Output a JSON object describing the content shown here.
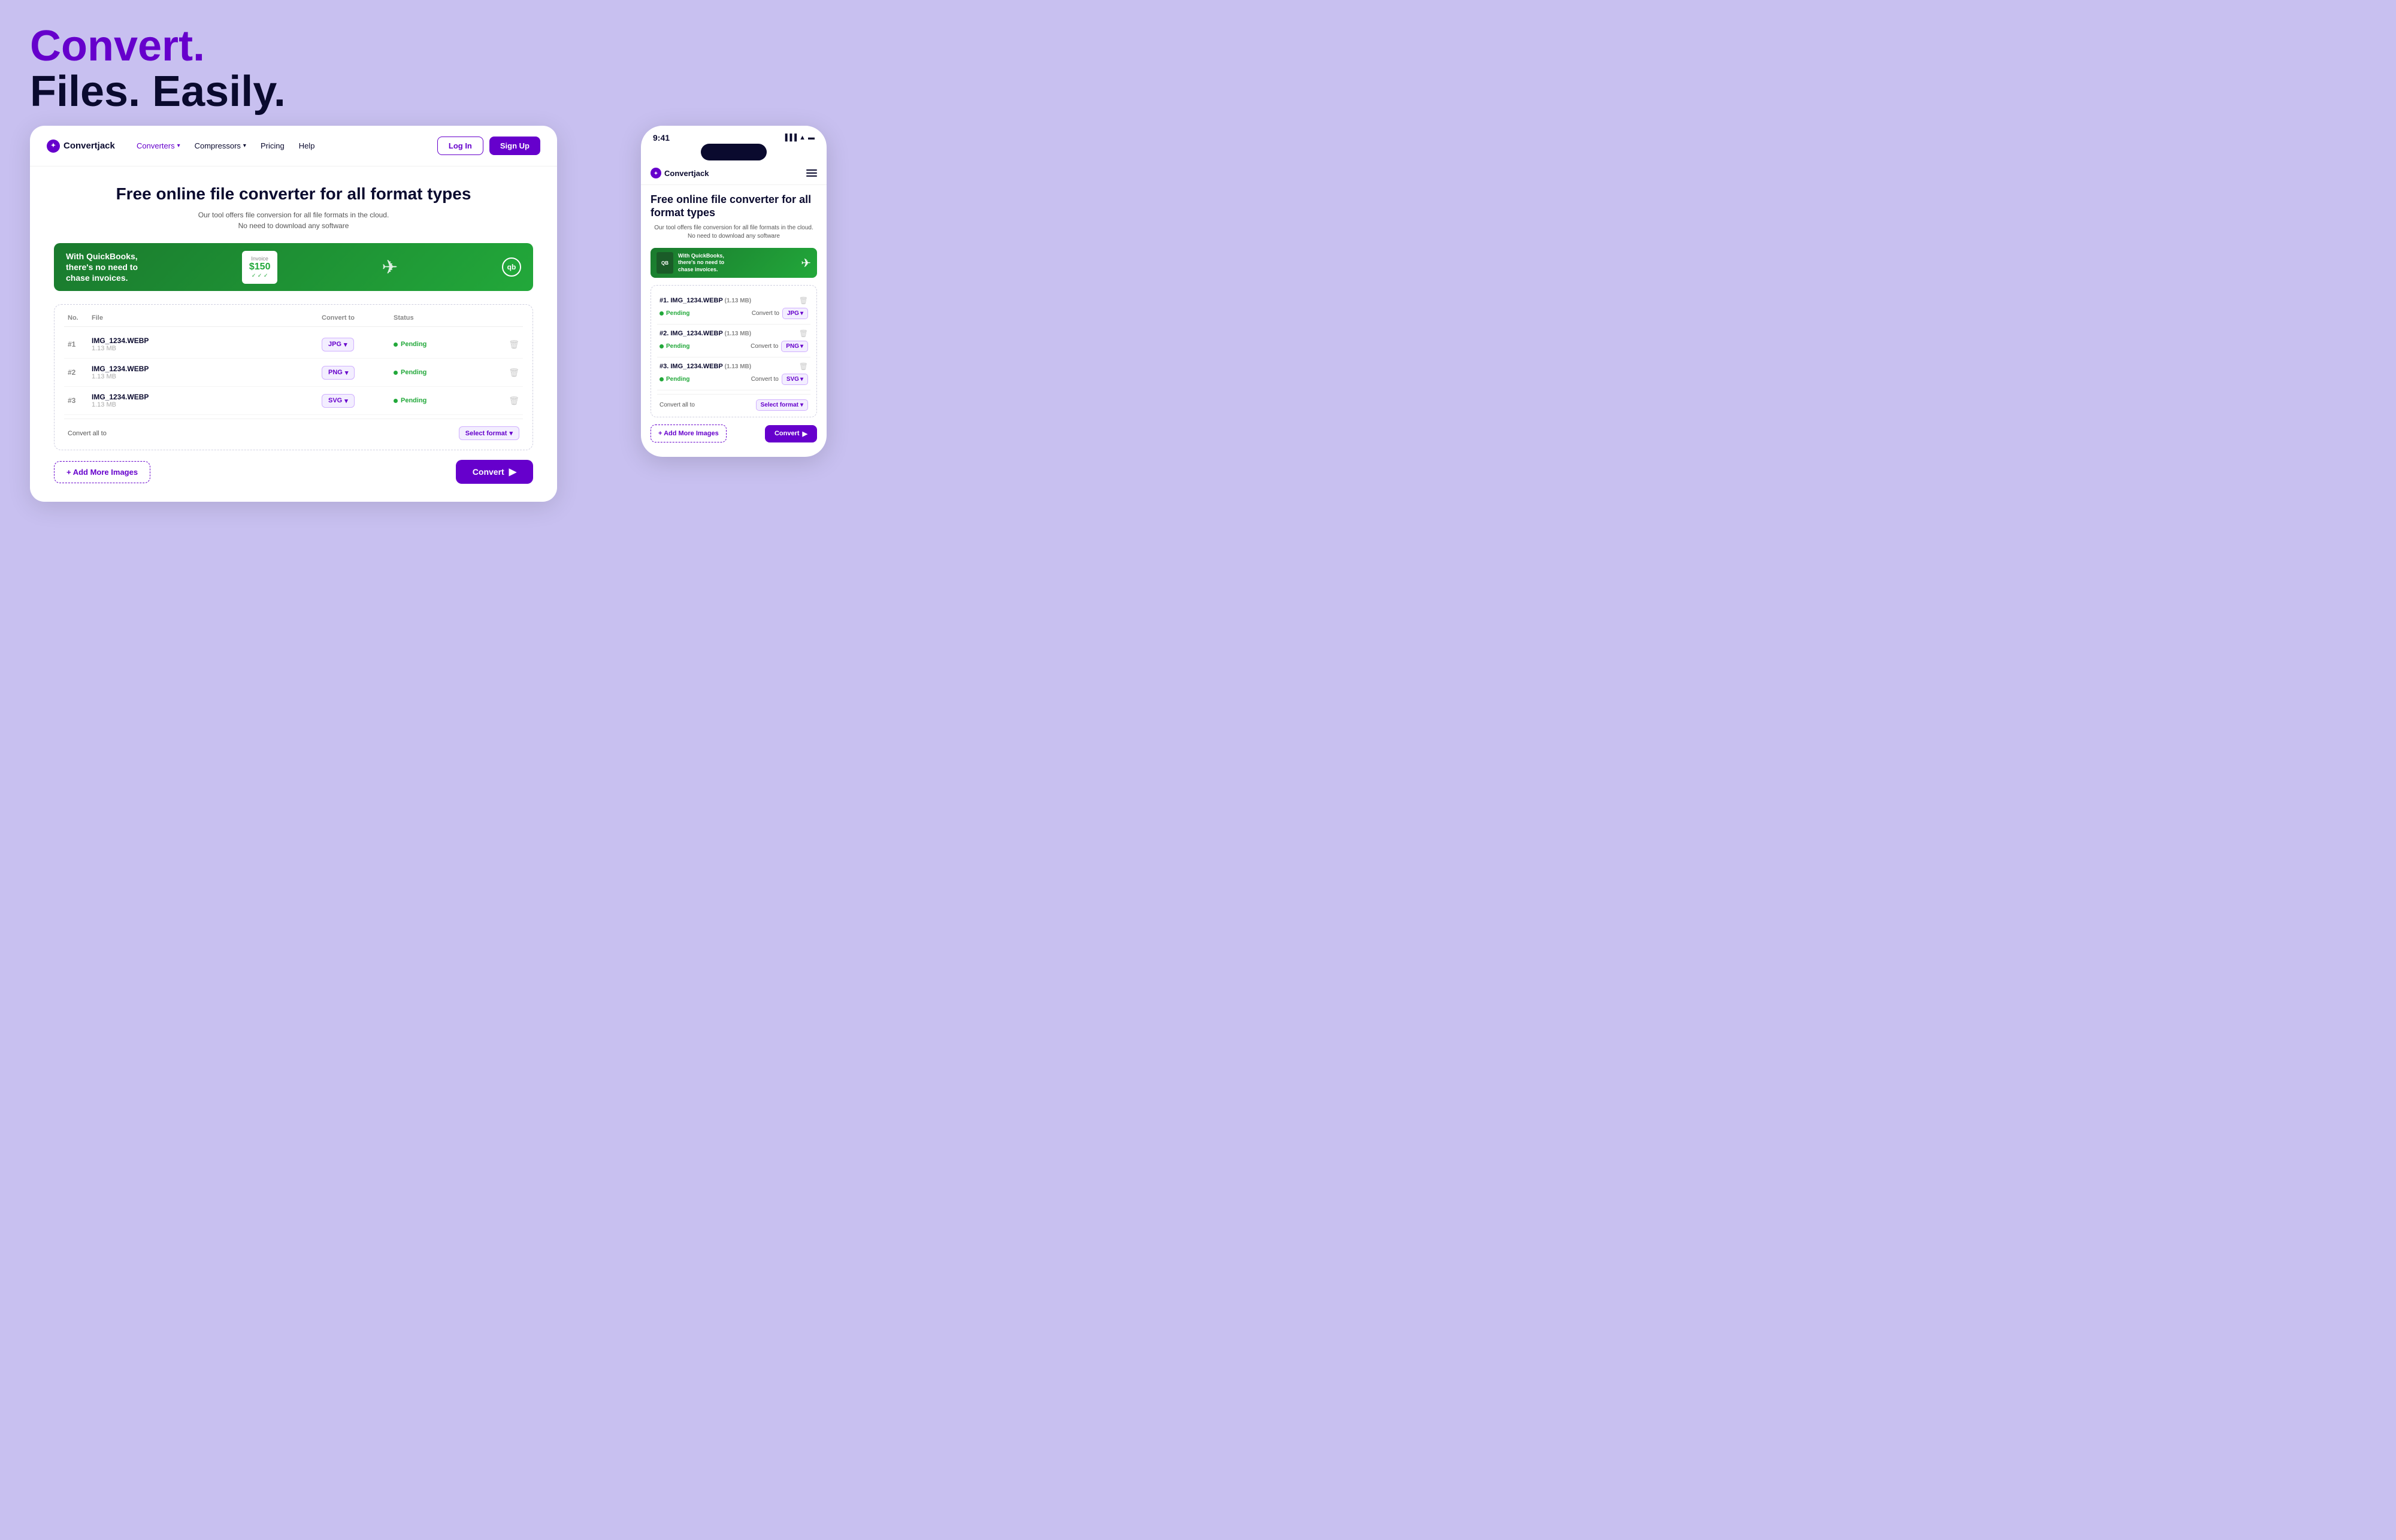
{
  "hero": {
    "title_purple": "Convert.",
    "title_dark": "Files. Easily."
  },
  "desktop": {
    "brand": "Convertjack",
    "nav": {
      "converters": "Converters",
      "compressors": "Compressors",
      "pricing": "Pricing",
      "help": "Help"
    },
    "buttons": {
      "login": "Log In",
      "signup": "Sign Up"
    },
    "page_heading": "Free online file converter for all format types",
    "page_subtext_line1": "Our tool offers file conversion for all file formats in the cloud.",
    "page_subtext_line2": "No need to download any software",
    "ad": {
      "text": "With QuickBooks,\nthere's no need to\nchase invoices.",
      "invoice_label": "Invoice",
      "amount": "$150",
      "qb": "qb"
    },
    "table": {
      "headers": {
        "no": "No.",
        "file": "File",
        "convert_to": "Convert to",
        "status": "Status"
      },
      "rows": [
        {
          "num": "#1",
          "name": "IMG_1234.WEBP",
          "size": "1.13 MB",
          "format": "JPG",
          "status": "Pending"
        },
        {
          "num": "#2",
          "name": "IMG_1234.WEBP",
          "size": "1.13 MB",
          "format": "PNG",
          "status": "Pending"
        },
        {
          "num": "#3",
          "name": "IMG_1234.WEBP",
          "size": "1.13 MB",
          "format": "SVG",
          "status": "Pending"
        }
      ],
      "convert_all_label": "Convert all to",
      "select_format": "Select format"
    },
    "add_images_btn": "+ Add More Images",
    "convert_btn": "Convert"
  },
  "mobile": {
    "time": "9:41",
    "brand": "Convertjack",
    "page_heading": "Free online file converter for all format types",
    "page_subtext": "Our tool offers file conversion for all file formats in the cloud. No need to download any software",
    "table": {
      "rows": [
        {
          "num": "#1.",
          "name": "IMG_1234.WEBP",
          "size": "(1.13 MB)",
          "format": "JPG",
          "status": "Pending",
          "convert_to": "Convert to"
        },
        {
          "num": "#2.",
          "name": "IMG_1234.WEBP",
          "size": "(1.13 MB)",
          "format": "PNG",
          "status": "Pending",
          "convert_to": "Convert to"
        },
        {
          "num": "#3.",
          "name": "IMG_1234.WEBP",
          "size": "(1.13 MB)",
          "format": "SVG",
          "status": "Pending",
          "convert_to": "Convert to"
        }
      ],
      "convert_all_label": "Convert all to",
      "select_format": "Select format"
    },
    "add_images_btn": "+ Add More Images",
    "convert_btn": "Convert"
  }
}
